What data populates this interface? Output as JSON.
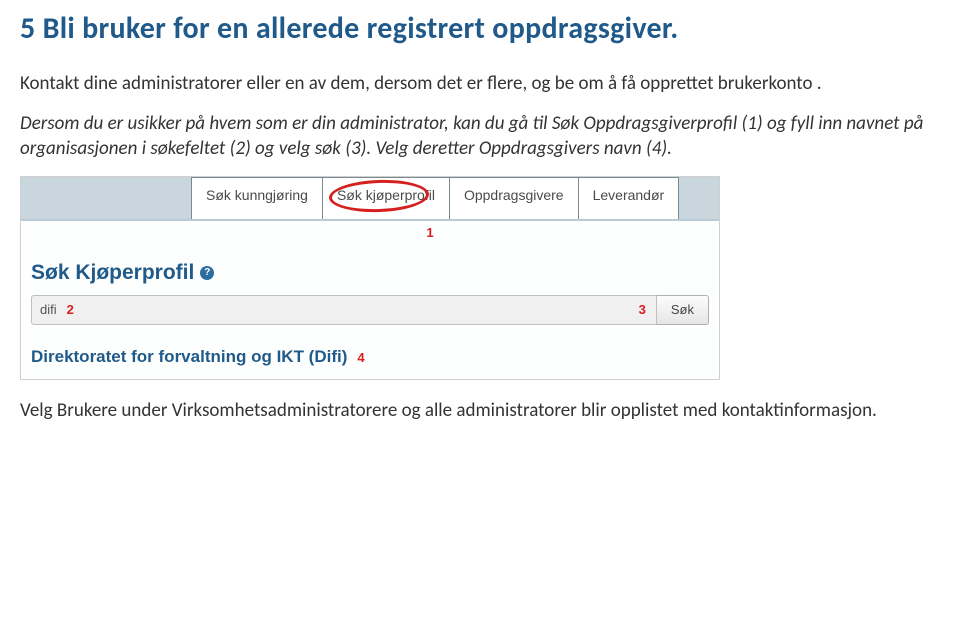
{
  "heading": "5 Bli bruker for en allerede registrert oppdragsgiver.",
  "para1": "Kontakt dine administratorer eller en av dem, dersom det er flere, og be om å få opprettet brukerkonto .",
  "para2": "Dersom du  er usikker på hvem som er din administrator, kan du gå til Søk Oppdragsgiverprofil (1) og fyll inn navnet på organisasjonen i søkefeltet (2) og velg søk (3). Velg deretter Oppdragsgivers navn (4).",
  "tabs": {
    "t1": "Søk kunngjøring",
    "t2": "Søk kjøperprofil",
    "t3": "Oppdragsgivere",
    "t4": "Leverandør"
  },
  "markers": {
    "m1": "1",
    "m2": "2",
    "m3": "3",
    "m4": "4"
  },
  "sectionTitle": "Søk Kjøperprofil",
  "helpGlyph": "?",
  "search": {
    "value": "difi",
    "button": "Søk"
  },
  "resultLink": "Direktoratet for forvaltning og IKT (Difi)",
  "para3": "Velg Brukere under Virksomhetsadministratorere og alle administratorer blir opplistet med kontaktinformasjon."
}
